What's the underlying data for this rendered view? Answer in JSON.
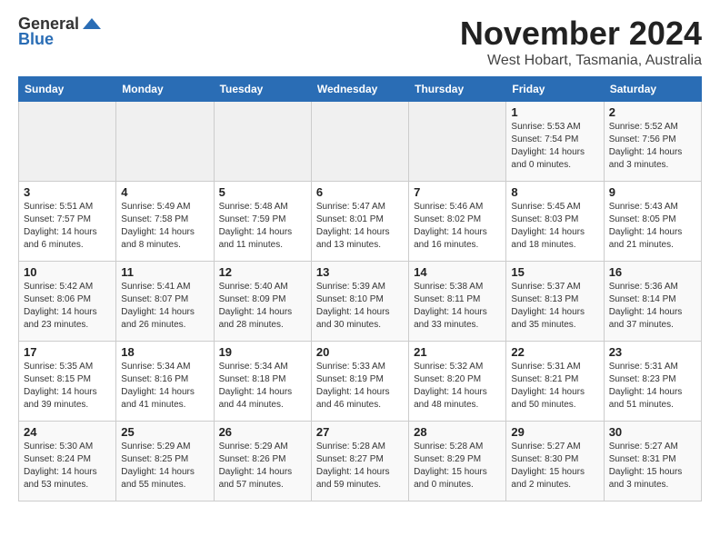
{
  "logo": {
    "general": "General",
    "blue": "Blue"
  },
  "title": {
    "month": "November 2024",
    "location": "West Hobart, Tasmania, Australia"
  },
  "headers": [
    "Sunday",
    "Monday",
    "Tuesday",
    "Wednesday",
    "Thursday",
    "Friday",
    "Saturday"
  ],
  "weeks": [
    [
      {
        "day": "",
        "info": ""
      },
      {
        "day": "",
        "info": ""
      },
      {
        "day": "",
        "info": ""
      },
      {
        "day": "",
        "info": ""
      },
      {
        "day": "",
        "info": ""
      },
      {
        "day": "1",
        "info": "Sunrise: 5:53 AM\nSunset: 7:54 PM\nDaylight: 14 hours and 0 minutes."
      },
      {
        "day": "2",
        "info": "Sunrise: 5:52 AM\nSunset: 7:56 PM\nDaylight: 14 hours and 3 minutes."
      }
    ],
    [
      {
        "day": "3",
        "info": "Sunrise: 5:51 AM\nSunset: 7:57 PM\nDaylight: 14 hours and 6 minutes."
      },
      {
        "day": "4",
        "info": "Sunrise: 5:49 AM\nSunset: 7:58 PM\nDaylight: 14 hours and 8 minutes."
      },
      {
        "day": "5",
        "info": "Sunrise: 5:48 AM\nSunset: 7:59 PM\nDaylight: 14 hours and 11 minutes."
      },
      {
        "day": "6",
        "info": "Sunrise: 5:47 AM\nSunset: 8:01 PM\nDaylight: 14 hours and 13 minutes."
      },
      {
        "day": "7",
        "info": "Sunrise: 5:46 AM\nSunset: 8:02 PM\nDaylight: 14 hours and 16 minutes."
      },
      {
        "day": "8",
        "info": "Sunrise: 5:45 AM\nSunset: 8:03 PM\nDaylight: 14 hours and 18 minutes."
      },
      {
        "day": "9",
        "info": "Sunrise: 5:43 AM\nSunset: 8:05 PM\nDaylight: 14 hours and 21 minutes."
      }
    ],
    [
      {
        "day": "10",
        "info": "Sunrise: 5:42 AM\nSunset: 8:06 PM\nDaylight: 14 hours and 23 minutes."
      },
      {
        "day": "11",
        "info": "Sunrise: 5:41 AM\nSunset: 8:07 PM\nDaylight: 14 hours and 26 minutes."
      },
      {
        "day": "12",
        "info": "Sunrise: 5:40 AM\nSunset: 8:09 PM\nDaylight: 14 hours and 28 minutes."
      },
      {
        "day": "13",
        "info": "Sunrise: 5:39 AM\nSunset: 8:10 PM\nDaylight: 14 hours and 30 minutes."
      },
      {
        "day": "14",
        "info": "Sunrise: 5:38 AM\nSunset: 8:11 PM\nDaylight: 14 hours and 33 minutes."
      },
      {
        "day": "15",
        "info": "Sunrise: 5:37 AM\nSunset: 8:13 PM\nDaylight: 14 hours and 35 minutes."
      },
      {
        "day": "16",
        "info": "Sunrise: 5:36 AM\nSunset: 8:14 PM\nDaylight: 14 hours and 37 minutes."
      }
    ],
    [
      {
        "day": "17",
        "info": "Sunrise: 5:35 AM\nSunset: 8:15 PM\nDaylight: 14 hours and 39 minutes."
      },
      {
        "day": "18",
        "info": "Sunrise: 5:34 AM\nSunset: 8:16 PM\nDaylight: 14 hours and 41 minutes."
      },
      {
        "day": "19",
        "info": "Sunrise: 5:34 AM\nSunset: 8:18 PM\nDaylight: 14 hours and 44 minutes."
      },
      {
        "day": "20",
        "info": "Sunrise: 5:33 AM\nSunset: 8:19 PM\nDaylight: 14 hours and 46 minutes."
      },
      {
        "day": "21",
        "info": "Sunrise: 5:32 AM\nSunset: 8:20 PM\nDaylight: 14 hours and 48 minutes."
      },
      {
        "day": "22",
        "info": "Sunrise: 5:31 AM\nSunset: 8:21 PM\nDaylight: 14 hours and 50 minutes."
      },
      {
        "day": "23",
        "info": "Sunrise: 5:31 AM\nSunset: 8:23 PM\nDaylight: 14 hours and 51 minutes."
      }
    ],
    [
      {
        "day": "24",
        "info": "Sunrise: 5:30 AM\nSunset: 8:24 PM\nDaylight: 14 hours and 53 minutes."
      },
      {
        "day": "25",
        "info": "Sunrise: 5:29 AM\nSunset: 8:25 PM\nDaylight: 14 hours and 55 minutes."
      },
      {
        "day": "26",
        "info": "Sunrise: 5:29 AM\nSunset: 8:26 PM\nDaylight: 14 hours and 57 minutes."
      },
      {
        "day": "27",
        "info": "Sunrise: 5:28 AM\nSunset: 8:27 PM\nDaylight: 14 hours and 59 minutes."
      },
      {
        "day": "28",
        "info": "Sunrise: 5:28 AM\nSunset: 8:29 PM\nDaylight: 15 hours and 0 minutes."
      },
      {
        "day": "29",
        "info": "Sunrise: 5:27 AM\nSunset: 8:30 PM\nDaylight: 15 hours and 2 minutes."
      },
      {
        "day": "30",
        "info": "Sunrise: 5:27 AM\nSunset: 8:31 PM\nDaylight: 15 hours and 3 minutes."
      }
    ]
  ]
}
